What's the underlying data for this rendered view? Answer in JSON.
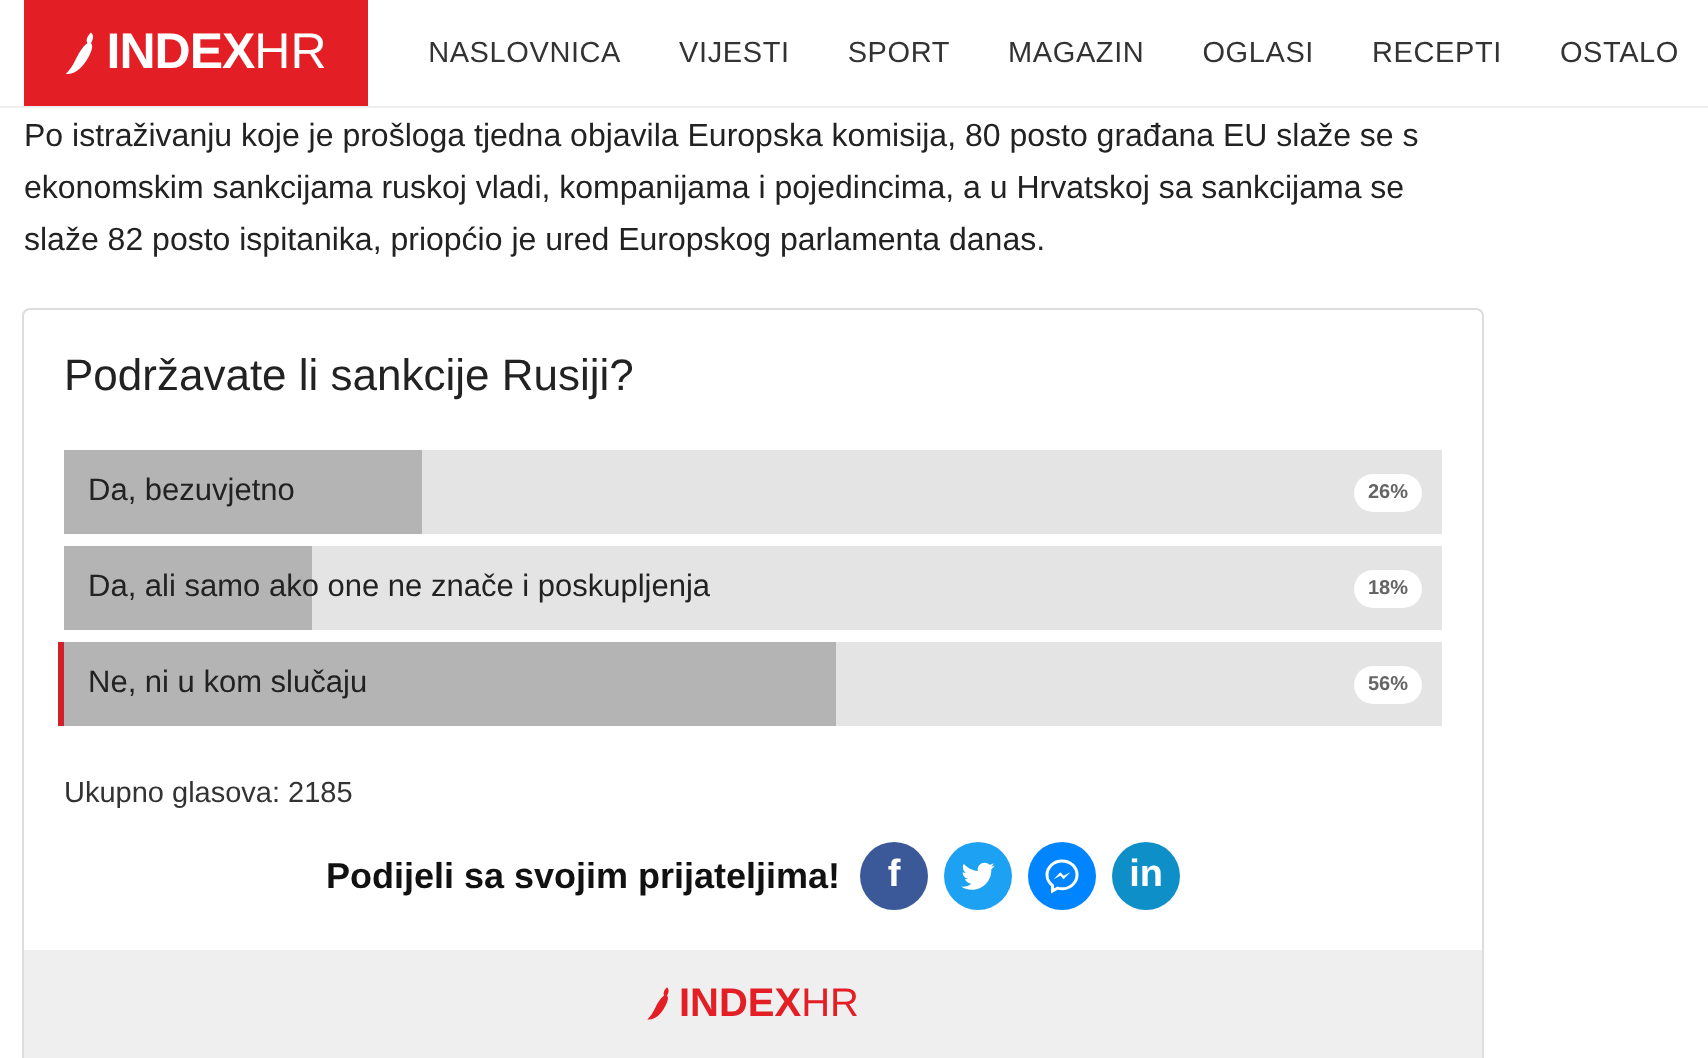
{
  "header": {
    "logo": {
      "bold": "INDEX",
      "light": "HR"
    },
    "nav": [
      {
        "label": "NASLOVNICA"
      },
      {
        "label": "VIJESTI"
      },
      {
        "label": "SPORT"
      },
      {
        "label": "MAGAZIN"
      },
      {
        "label": "OGLASI"
      },
      {
        "label": "RECEPTI"
      },
      {
        "label": "OSTALO"
      }
    ]
  },
  "article": {
    "paragraph": "Po istraživanju koje je prošloga tjedna objavila Europska komisija, 80 posto građana EU slaže se s ekonomskim sankcijama ruskoj vladi, kompanijama i pojedincima, a u Hrvatskoj sa sankcijama se slaže 82 posto ispitanika, priopćio je ured Europskog parlamenta danas."
  },
  "poll": {
    "question": "Podržavate li sankcije Rusiji?",
    "options": [
      {
        "label": "Da, bezuvjetno",
        "level": 0.26,
        "percent": "26%",
        "selected": false
      },
      {
        "label": "Da, ali samo ako one ne znače i poskupljenja",
        "level": 0.18,
        "percent": "18%",
        "selected": false
      },
      {
        "label": "Ne, ni u kom slučaju",
        "level": 0.56,
        "percent": "56%",
        "selected": true
      }
    ],
    "total_votes": "Ukupno glasova: 2185",
    "share": {
      "label": "Podijeli sa svojim prijateljima!",
      "buttons": [
        {
          "kind": "facebook",
          "glyph": "f"
        },
        {
          "kind": "twitter"
        },
        {
          "kind": "messenger"
        },
        {
          "kind": "linkedin",
          "glyph": "in"
        }
      ]
    },
    "footer_logo": {
      "bold": "INDEX",
      "light": "HR"
    }
  }
}
